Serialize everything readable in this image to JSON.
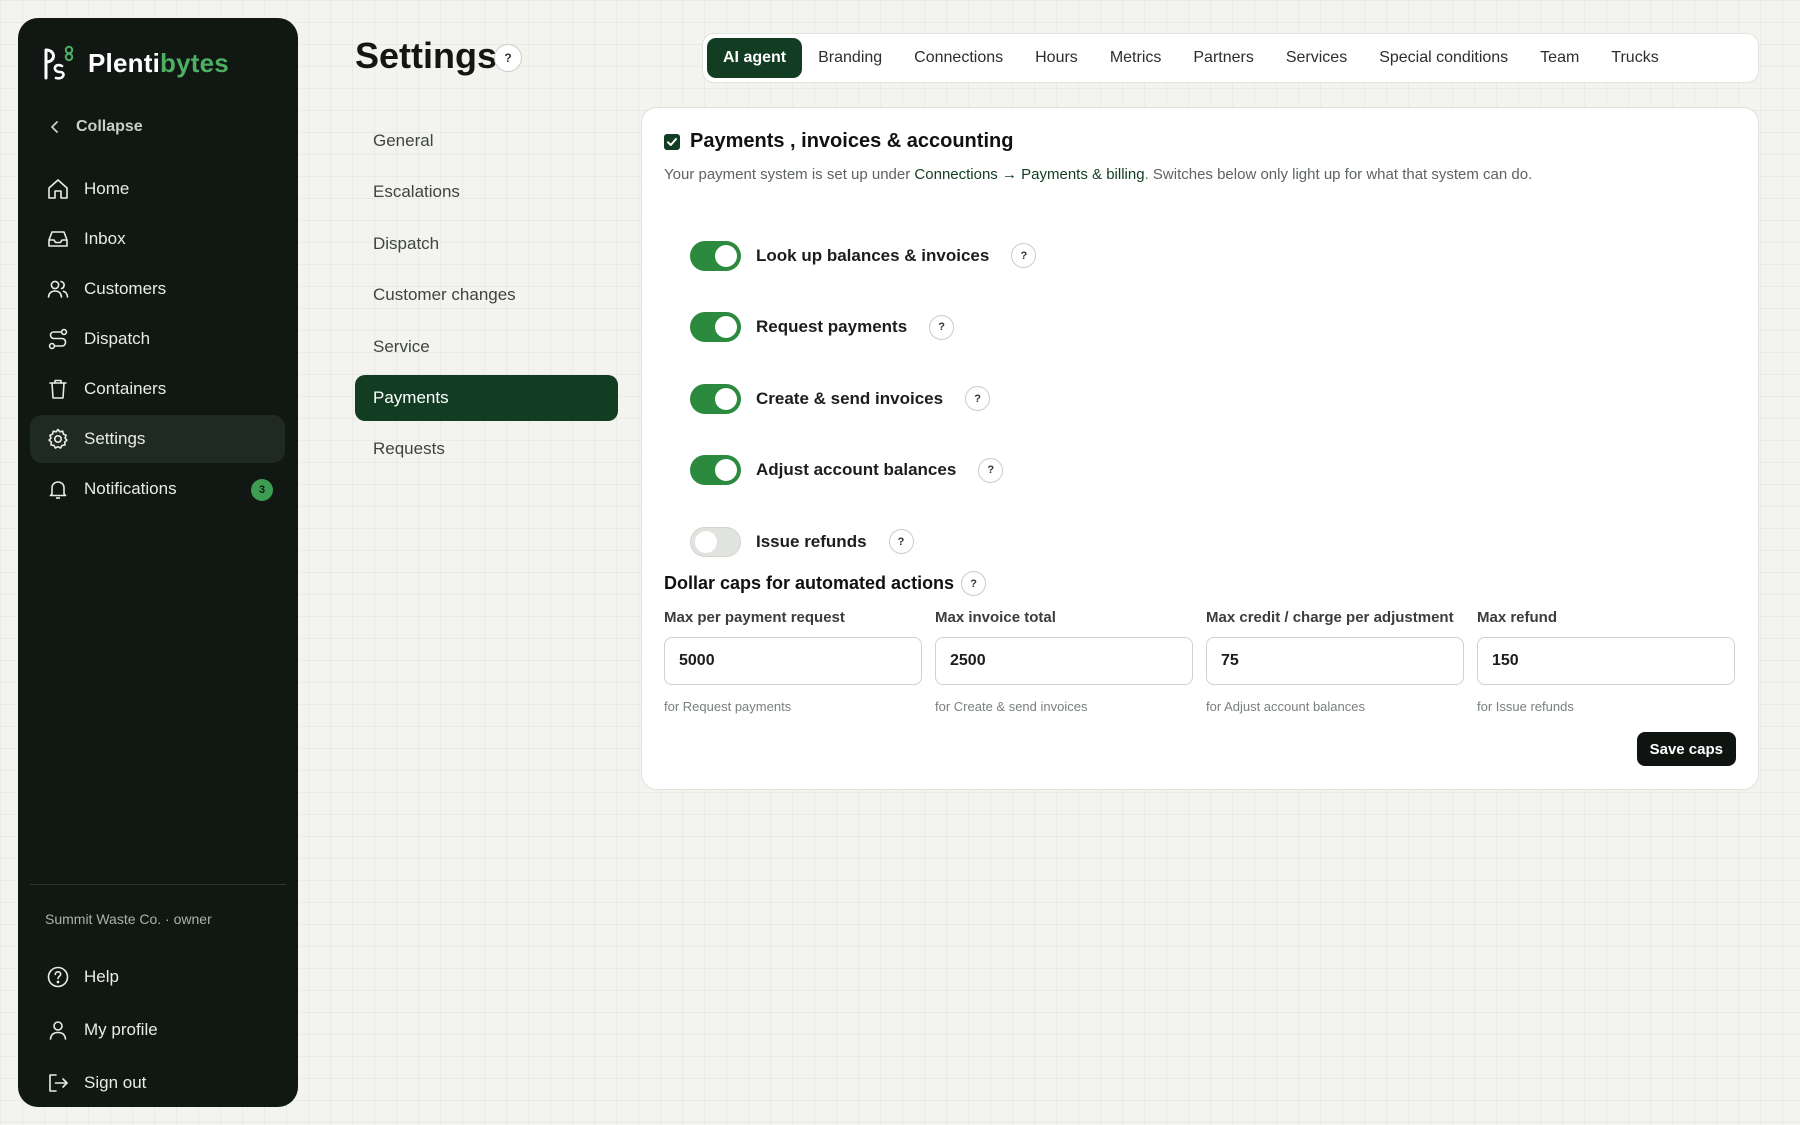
{
  "brand": {
    "name_part1": "Plenti",
    "name_part2": "bytes",
    "logo_icon": "plentibytes-logo-icon"
  },
  "sidebar": {
    "collapse_label": "Collapse",
    "items": [
      {
        "label": "Home",
        "icon": "home-icon"
      },
      {
        "label": "Inbox",
        "icon": "inbox-icon"
      },
      {
        "label": "Customers",
        "icon": "users-icon"
      },
      {
        "label": "Dispatch",
        "icon": "route-icon"
      },
      {
        "label": "Containers",
        "icon": "trash-bin-icon"
      },
      {
        "label": "Settings",
        "icon": "gear-icon",
        "active": true
      },
      {
        "label": "Notifications",
        "icon": "bell-icon",
        "badge": "3"
      }
    ],
    "owner": "Summit Waste Co. · owner",
    "bottom_items": [
      {
        "label": "Help",
        "icon": "help-icon"
      },
      {
        "label": "My profile",
        "icon": "user-icon"
      },
      {
        "label": "Sign out",
        "icon": "sign-out-icon"
      }
    ]
  },
  "header": {
    "title": "Settings",
    "help": "?"
  },
  "tabs": [
    {
      "label": "AI agent",
      "active": true
    },
    {
      "label": "Branding"
    },
    {
      "label": "Connections"
    },
    {
      "label": "Hours"
    },
    {
      "label": "Metrics"
    },
    {
      "label": "Partners"
    },
    {
      "label": "Services"
    },
    {
      "label": "Special conditions"
    },
    {
      "label": "Team"
    },
    {
      "label": "Trucks"
    }
  ],
  "subnav": [
    {
      "label": "General"
    },
    {
      "label": "Escalations"
    },
    {
      "label": "Dispatch"
    },
    {
      "label": "Customer changes"
    },
    {
      "label": "Service"
    },
    {
      "label": "Payments",
      "active": true
    },
    {
      "label": "Requests"
    }
  ],
  "card": {
    "title": "Payments ,  invoices & accounting",
    "enabled": true,
    "desc_prefix": "Your payment system is set up under ",
    "desc_link1": "Connections",
    "desc_arrow": "→",
    "desc_link2": "Payments & billing",
    "desc_suffix": ". Switches below only light up for what that system can do.",
    "toggles": [
      {
        "label": "Look up balances & invoices",
        "on": true,
        "help": "?"
      },
      {
        "label": "Request payments",
        "on": true,
        "help": "?"
      },
      {
        "label": "Create & send invoices",
        "on": true,
        "help": "?"
      },
      {
        "label": "Adjust account balances",
        "on": true,
        "help": "?"
      },
      {
        "label": "Issue refunds",
        "on": false,
        "help": "?"
      }
    ],
    "caps_title": "Dollar caps for automated actions",
    "caps_help": "?",
    "caps": [
      {
        "label": "Max per payment request",
        "value": "5000",
        "hint": "for Request payments"
      },
      {
        "label": "Max invoice total",
        "value": "2500",
        "hint": "for Create & send invoices"
      },
      {
        "label": "Max credit / charge per adjustment",
        "value": "75",
        "hint": "for Adjust account balances"
      },
      {
        "label": "Max refund",
        "value": "150",
        "hint": "for Issue refunds"
      }
    ],
    "save_label": "Save caps"
  },
  "colors": {
    "accent": "#123d22",
    "switch_on": "#2c8a3e",
    "sidebar_bg": "#111713",
    "brand_green": "#4caf62"
  }
}
